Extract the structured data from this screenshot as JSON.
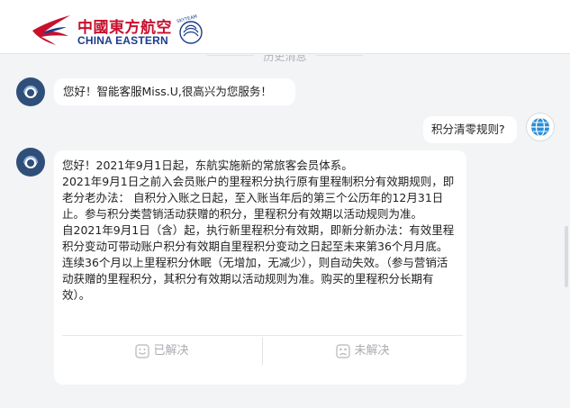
{
  "header": {
    "logo_cn": "中國東方航空",
    "logo_en": "CHINA EASTERN",
    "alliance_text": "SKYTEAM",
    "brand_red": "#c8102e",
    "brand_blue": "#1a3c8a"
  },
  "chat": {
    "history_label": "历史消息",
    "messages": [
      {
        "from": "bot",
        "text": "您好！智能客服Miss.U,很高兴为您服务！"
      },
      {
        "from": "user",
        "text": "积分清零规则?"
      },
      {
        "from": "bot",
        "paragraphs": [
          "您好！2021年9月1日起，东航实施新的常旅客会员体系。",
          "2021年9月1日之前入会员账户的里程积分执行原有里程制积分有效期规则，即老分老办法： 自积分入账之日起，至入账当年后的第三个公历年的12月31日止。参与积分类营销活动获赠的积分，里程积分有效期以活动规则为准。",
          "自2021年9月1日（含）起，执行新里程积分有效期，即新分新办法：有效里程积分变动可带动账户积分有效期自里程积分变动之日起至未来第36个月月底。连续36个月以上里程积分休眠（无增加，无减少），则自动失效。（参与营销活动获赠的里程积分，其积分有效期以活动规则为准。购买的里程积分长期有效）。"
        ],
        "feedback": {
          "solved_label": "已解决",
          "unsolved_label": "未解决"
        }
      }
    ]
  }
}
